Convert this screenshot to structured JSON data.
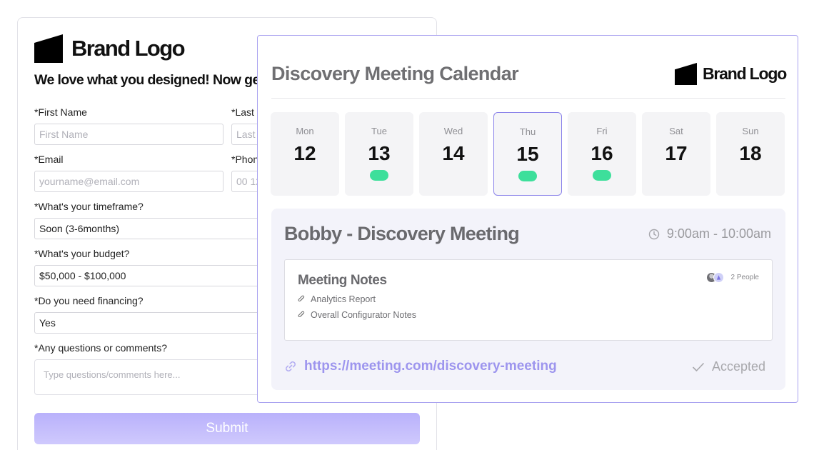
{
  "form": {
    "brand_logo": "Brand Logo",
    "headline": "We love what you designed! Now ge",
    "first_name": {
      "label": "*First Name",
      "placeholder": "First Name"
    },
    "last_name": {
      "label": "*Last N",
      "placeholder": "Last"
    },
    "email": {
      "label": "*Email",
      "placeholder": "yourname@email.com"
    },
    "phone": {
      "label": "*Phon",
      "placeholder": "00 12"
    },
    "timeframe": {
      "label": "*What's your timeframe?",
      "value": "Soon (3-6months)"
    },
    "budget": {
      "label": "*What's your budget?",
      "value": "$50,000 - $100,000"
    },
    "financing": {
      "label": "*Do you need financing?",
      "value": "Yes"
    },
    "comments": {
      "label": "*Any questions or comments?",
      "placeholder": "Type questions/comments here..."
    },
    "submit_label": "Submit"
  },
  "calendar": {
    "title": "Discovery Meeting Calendar",
    "brand_logo": "Brand Logo",
    "days": [
      {
        "name": "Mon",
        "num": "12",
        "has_meeting": false,
        "selected": false
      },
      {
        "name": "Tue",
        "num": "13",
        "has_meeting": true,
        "selected": false
      },
      {
        "name": "Wed",
        "num": "14",
        "has_meeting": false,
        "selected": false
      },
      {
        "name": "Thu",
        "num": "15",
        "has_meeting": true,
        "selected": true
      },
      {
        "name": "Fri",
        "num": "16",
        "has_meeting": true,
        "selected": false
      },
      {
        "name": "Sat",
        "num": "17",
        "has_meeting": false,
        "selected": false
      },
      {
        "name": "Sun",
        "num": "18",
        "has_meeting": false,
        "selected": false
      }
    ],
    "meeting": {
      "title": "Bobby - Discovery Meeting",
      "time": "9:00am - 10:00am",
      "notes_title": "Meeting Notes",
      "notes": [
        "Analytics Report",
        "Overall Configurator Notes"
      ],
      "people_count": "2 People",
      "link": "https://meeting.com/discovery-meeting",
      "status": "Accepted"
    }
  },
  "colors": {
    "accent": "#9d95ee",
    "meeting_dot": "#3ddf9b",
    "card_border": "#aaa3f0",
    "submit_bg": "#c3bbfc"
  }
}
